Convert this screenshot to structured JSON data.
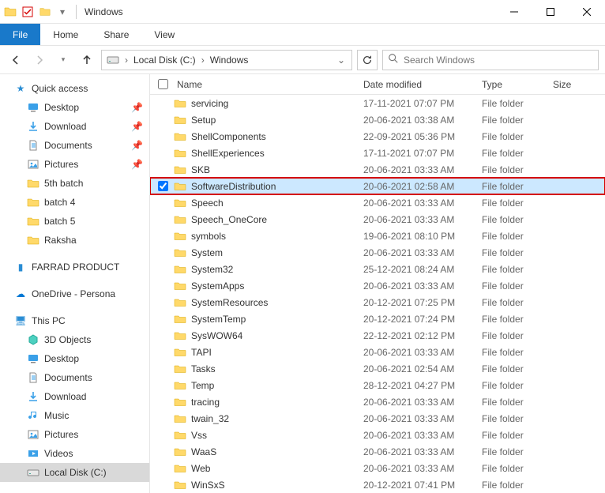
{
  "title": "Windows",
  "ribbon": {
    "file": "File",
    "tabs": [
      "Home",
      "Share",
      "View"
    ]
  },
  "breadcrumb": [
    "Local Disk (C:)",
    "Windows"
  ],
  "search": {
    "placeholder": "Search Windows"
  },
  "columns": {
    "name": "Name",
    "date": "Date modified",
    "type": "Type",
    "size": "Size"
  },
  "nav": {
    "quick_access": {
      "label": "Quick access",
      "items": [
        {
          "label": "Desktop",
          "icon": "desktop",
          "pin": true
        },
        {
          "label": "Download",
          "icon": "download",
          "pin": true
        },
        {
          "label": "Documents",
          "icon": "documents",
          "pin": true
        },
        {
          "label": "Pictures",
          "icon": "pictures",
          "pin": true
        },
        {
          "label": "5th batch",
          "icon": "folder"
        },
        {
          "label": "batch 4",
          "icon": "folder"
        },
        {
          "label": "batch 5",
          "icon": "folder"
        },
        {
          "label": "Raksha",
          "icon": "folder"
        }
      ]
    },
    "farrad": {
      "label": "FARRAD PRODUCT"
    },
    "onedrive": {
      "label": "OneDrive - Persona"
    },
    "this_pc": {
      "label": "This PC",
      "items": [
        {
          "label": "3D Objects",
          "icon": "3d"
        },
        {
          "label": "Desktop",
          "icon": "desktop"
        },
        {
          "label": "Documents",
          "icon": "documents"
        },
        {
          "label": "Download",
          "icon": "download"
        },
        {
          "label": "Music",
          "icon": "music"
        },
        {
          "label": "Pictures",
          "icon": "pictures"
        },
        {
          "label": "Videos",
          "icon": "videos"
        },
        {
          "label": "Local Disk (C:)",
          "icon": "disk",
          "highlight": true
        }
      ]
    }
  },
  "files": [
    {
      "name": "servicing",
      "date": "17-11-2021 07:07 PM",
      "type": "File folder"
    },
    {
      "name": "Setup",
      "date": "20-06-2021 03:38 AM",
      "type": "File folder"
    },
    {
      "name": "ShellComponents",
      "date": "22-09-2021 05:36 PM",
      "type": "File folder"
    },
    {
      "name": "ShellExperiences",
      "date": "17-11-2021 07:07 PM",
      "type": "File folder"
    },
    {
      "name": "SKB",
      "date": "20-06-2021 03:33 AM",
      "type": "File folder"
    },
    {
      "name": "SoftwareDistribution",
      "date": "20-06-2021 02:58 AM",
      "type": "File folder",
      "selected": true,
      "checked": true
    },
    {
      "name": "Speech",
      "date": "20-06-2021 03:33 AM",
      "type": "File folder"
    },
    {
      "name": "Speech_OneCore",
      "date": "20-06-2021 03:33 AM",
      "type": "File folder"
    },
    {
      "name": "symbols",
      "date": "19-06-2021 08:10 PM",
      "type": "File folder"
    },
    {
      "name": "System",
      "date": "20-06-2021 03:33 AM",
      "type": "File folder"
    },
    {
      "name": "System32",
      "date": "25-12-2021 08:24 AM",
      "type": "File folder"
    },
    {
      "name": "SystemApps",
      "date": "20-06-2021 03:33 AM",
      "type": "File folder"
    },
    {
      "name": "SystemResources",
      "date": "20-12-2021 07:25 PM",
      "type": "File folder"
    },
    {
      "name": "SystemTemp",
      "date": "20-12-2021 07:24 PM",
      "type": "File folder"
    },
    {
      "name": "SysWOW64",
      "date": "22-12-2021 02:12 PM",
      "type": "File folder"
    },
    {
      "name": "TAPI",
      "date": "20-06-2021 03:33 AM",
      "type": "File folder"
    },
    {
      "name": "Tasks",
      "date": "20-06-2021 02:54 AM",
      "type": "File folder"
    },
    {
      "name": "Temp",
      "date": "28-12-2021 04:27 PM",
      "type": "File folder"
    },
    {
      "name": "tracing",
      "date": "20-06-2021 03:33 AM",
      "type": "File folder"
    },
    {
      "name": "twain_32",
      "date": "20-06-2021 03:33 AM",
      "type": "File folder"
    },
    {
      "name": "Vss",
      "date": "20-06-2021 03:33 AM",
      "type": "File folder"
    },
    {
      "name": "WaaS",
      "date": "20-06-2021 03:33 AM",
      "type": "File folder"
    },
    {
      "name": "Web",
      "date": "20-06-2021 03:33 AM",
      "type": "File folder"
    },
    {
      "name": "WinSxS",
      "date": "20-12-2021 07:41 PM",
      "type": "File folder"
    }
  ]
}
